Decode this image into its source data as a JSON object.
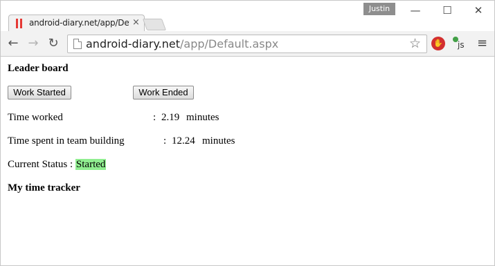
{
  "window": {
    "user_name": "Justin",
    "minimize_glyph": "—",
    "maximize_glyph": "☐",
    "close_glyph": "✕"
  },
  "tab": {
    "title": "android-diary.net/app/Def",
    "close_glyph": "×"
  },
  "toolbar": {
    "back_glyph": "←",
    "forward_glyph": "→",
    "reload_glyph": "↻",
    "url_host": "android-diary.net",
    "url_path": "/app/Default.aspx",
    "star_glyph": "☆",
    "menu_glyph": "≡",
    "ext_js_label": "js"
  },
  "page": {
    "leaderboard_heading": "Leader board",
    "work_started_button": "Work Started",
    "work_ended_button": "Work Ended",
    "time_worked_label": "Time worked",
    "time_worked_value": "2.19",
    "time_worked_unit": "minutes",
    "team_building_label": "Time spent in team building",
    "team_building_value": "12.24",
    "team_building_unit": "minutes",
    "colon": ":",
    "current_status_label": "Current Status :",
    "current_status_value": "Started",
    "tracker_heading": "My time tracker"
  },
  "colors": {
    "status_started": "#90ee90",
    "ext_stop": "#d32f2f"
  },
  "icons": {
    "favicon": "red-bars-icon",
    "page": "page-icon",
    "bookmark": "star-icon",
    "stop_extension": "stop-hand-icon",
    "js_extension": "js-toggle-icon",
    "menu": "hamburger-menu-icon"
  }
}
